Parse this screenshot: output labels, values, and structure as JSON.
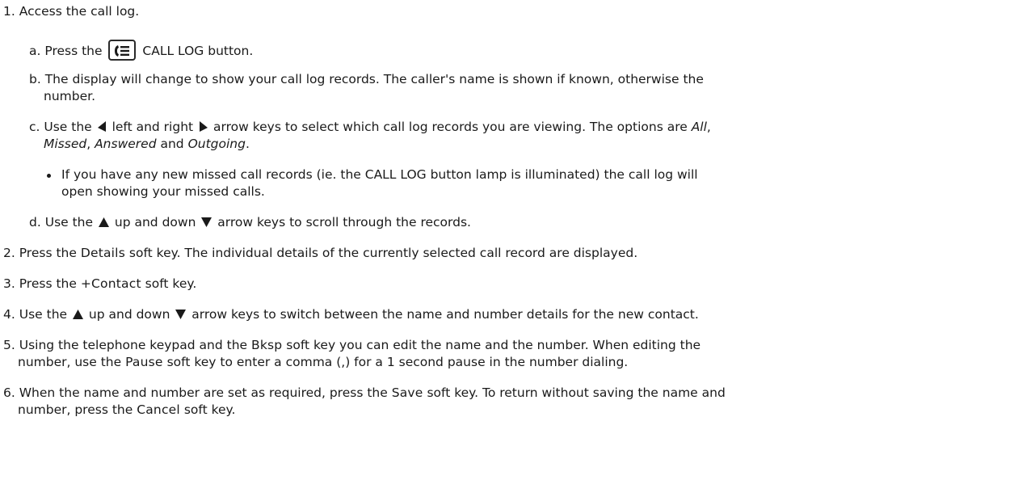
{
  "steps": [
    {
      "num": "1.",
      "text": "Access the call log."
    },
    {
      "num": "2.",
      "pre": "Press the ",
      "key": "Details",
      "post": " soft key. The individual details of the currently selected call record are displayed."
    },
    {
      "num": "3.",
      "pre": "Press the ",
      "key": "+Contact",
      "post": " soft key."
    },
    {
      "num": "4.",
      "pre": "Use the ",
      "mid": " up and down ",
      "post": " arrow keys to switch between the name and number details for the new contact."
    },
    {
      "num": "5.",
      "line1_pre": "Using the telephone keypad and the ",
      "line1_key": "Bksp",
      "line1_post": " soft key you can edit the name and the number. When editing the",
      "line2_pre": "number, use the ",
      "line2_key": "Pause",
      "line2_post": " soft key to enter a comma (,) for a 1 second pause in the number dialing."
    },
    {
      "num": "6.",
      "line1_pre": "When the name and number are set as required, press the ",
      "line1_key": "Save",
      "line1_post": " soft key. To return without saving the name and",
      "line2_pre": "number, press the ",
      "line2_key": "Cancel",
      "line2_post": " soft key."
    }
  ],
  "substeps": [
    {
      "letter": "a.",
      "pre": "Press the ",
      "post": " CALL LOG button."
    },
    {
      "letter": "b.",
      "line1": "The display will change to show your call log records. The caller's name is shown if known, otherwise the",
      "line2": "number."
    },
    {
      "letter": "c.",
      "pre": "Use the ",
      "mid": " left and right ",
      "post": " arrow keys to select which call log records you are viewing. The options are ",
      "opt_all": "All",
      "opt_missed": "Missed",
      "opt_answered": "Answered",
      "opt_outgoing": "Outgoing",
      "sep1": ",",
      "sep2": ", ",
      "and": " and ",
      "end": "."
    },
    {
      "letter": "d.",
      "pre": "Use the ",
      "mid": " up and down ",
      "post": " arrow keys to scroll through the records."
    }
  ],
  "bullet": {
    "line1": "If you have any new missed call records (ie. the CALL LOG button lamp is illuminated) the call log will",
    "line2": "open showing your missed calls."
  },
  "icons": {
    "call_log_button": "call-log-button-icon",
    "left": "left-arrow-icon",
    "right": "right-arrow-icon",
    "up": "up-arrow-icon",
    "down": "down-arrow-icon"
  }
}
